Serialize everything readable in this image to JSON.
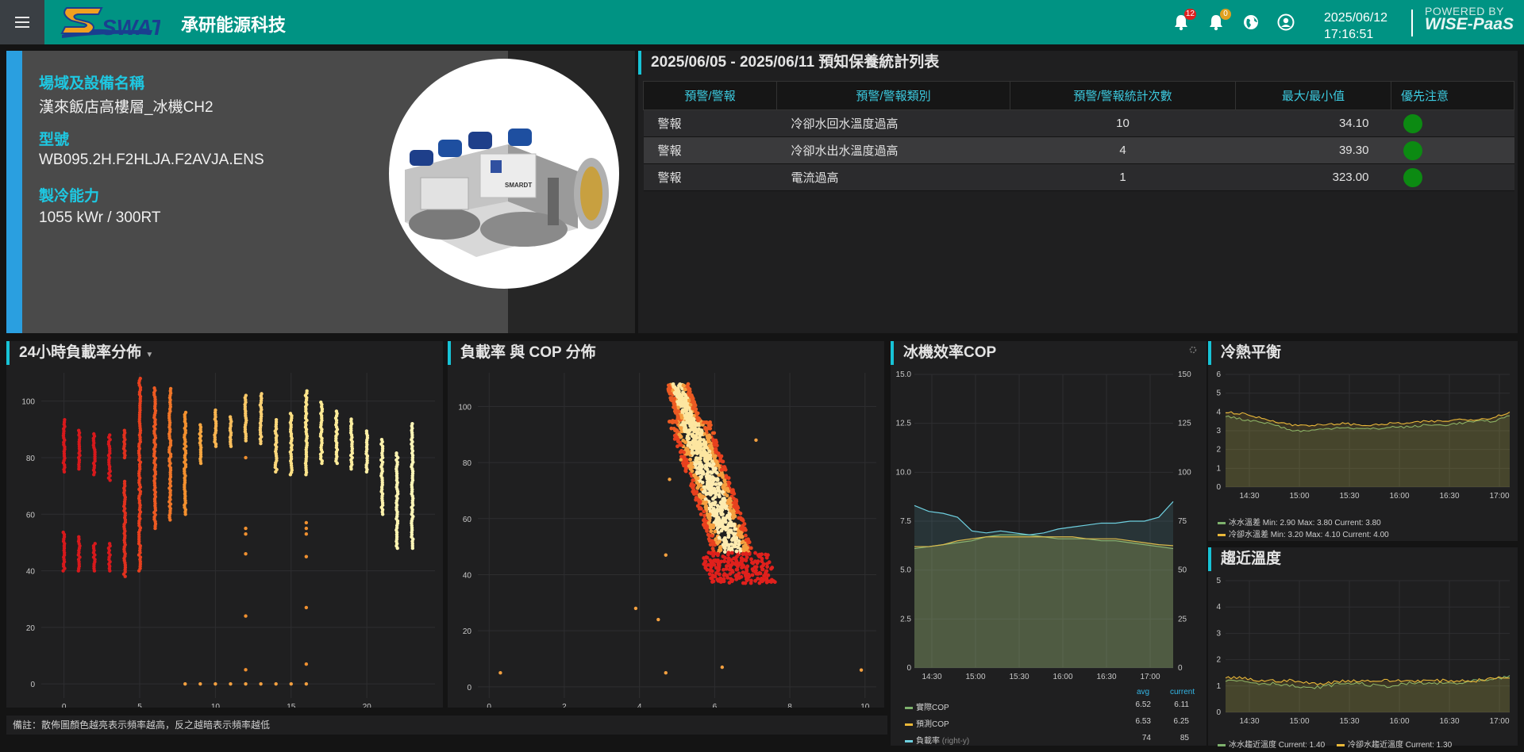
{
  "header": {
    "brand": "承研能源科技",
    "logo_text": "SWAT",
    "notif_count_red": "12",
    "notif_count_yellow": "0",
    "date": "2025/06/12",
    "time": "17:16:51",
    "powered_line1": "POWERED BY",
    "powered_line2": "WISE-PaaS",
    "colors": {
      "bar": "#009383",
      "badge_red": "#e02020",
      "badge_yellow": "#e0a020"
    }
  },
  "equipment": {
    "site_label": "場域及設備名稱",
    "site_value": "漢來飯店高樓層_冰機CH2",
    "model_label": "型號",
    "model_value": "WB095.2H.F2HLJA.F2AVJA.ENS",
    "capacity_label": "製冷能力",
    "capacity_value": "1055 kWr / 300RT",
    "image_logo": "SMARDT"
  },
  "maintenance": {
    "title": "2025/06/05 - 2025/06/11 預知保養統計列表",
    "columns": [
      "預警/警報",
      "預警/警報類別",
      "預警/警報統計次數",
      "最大/最小值",
      "優先注意"
    ],
    "rows": [
      {
        "level": "警報",
        "category": "冷卻水回水溫度過高",
        "count": "10",
        "value": "34.10",
        "priority": "green"
      },
      {
        "level": "警報",
        "category": "冷卻水出水溫度過高",
        "count": "4",
        "value": "39.30",
        "priority": "green"
      },
      {
        "level": "警報",
        "category": "電流過高",
        "count": "1",
        "value": "323.00",
        "priority": "green"
      }
    ]
  },
  "load_24h": {
    "title": "24小時負載率分佈",
    "chart_data": {
      "type": "scatter",
      "title": "24小時負載率分佈",
      "xlim": [
        -1.5,
        24.5
      ],
      "ylim": [
        -5,
        110
      ],
      "x_ticks": [
        0,
        5,
        10,
        15,
        20
      ],
      "y_ticks": [
        0,
        20,
        40,
        60,
        80,
        100
      ],
      "columns": [
        {
          "x": 0,
          "ranges": [
            [
              40,
              54
            ],
            [
              75,
              94
            ]
          ],
          "color": "#d7191c"
        },
        {
          "x": 1,
          "ranges": [
            [
              40,
              52
            ],
            [
              76,
              90
            ]
          ],
          "color": "#d7191c"
        },
        {
          "x": 2,
          "ranges": [
            [
              40,
              50
            ],
            [
              74,
              89
            ]
          ],
          "color": "#d7191c"
        },
        {
          "x": 3,
          "ranges": [
            [
              40,
              50
            ],
            [
              72,
              88
            ]
          ],
          "color": "#d7191c"
        },
        {
          "x": 4,
          "ranges": [
            [
              38,
              72
            ],
            [
              80,
              90
            ]
          ],
          "color": "#e0301e"
        },
        {
          "x": 5,
          "ranges": [
            [
              40,
              108
            ]
          ],
          "color": "#e8401e"
        },
        {
          "x": 6,
          "ranges": [
            [
              55,
              105
            ]
          ],
          "color": "#ec5a22"
        },
        {
          "x": 7,
          "ranges": [
            [
              58,
              105
            ]
          ],
          "color": "#f07628"
        },
        {
          "x": 8,
          "ranges": [
            [
              60,
              96
            ]
          ],
          "color": "#f3902e"
        },
        {
          "x": 9,
          "ranges": [
            [
              78,
              92
            ]
          ],
          "color": "#f6a640"
        },
        {
          "x": 10,
          "ranges": [
            [
              84,
              97
            ]
          ],
          "color": "#f8b450"
        },
        {
          "x": 11,
          "ranges": [
            [
              84,
              95
            ]
          ],
          "color": "#f9be5c"
        },
        {
          "x": 12,
          "ranges": [
            [
              86,
              102
            ]
          ],
          "color": "#fac867"
        },
        {
          "x": 13,
          "ranges": [
            [
              85,
              103
            ]
          ],
          "color": "#fbd073"
        },
        {
          "x": 14,
          "ranges": [
            [
              75,
              94
            ]
          ],
          "color": "#fcd87c"
        },
        {
          "x": 15,
          "ranges": [
            [
              74,
              96
            ]
          ],
          "color": "#fde084"
        },
        {
          "x": 16,
          "ranges": [
            [
              74,
              104
            ]
          ],
          "color": "#fde58c"
        },
        {
          "x": 17,
          "ranges": [
            [
              78,
              100
            ]
          ],
          "color": "#fdea94"
        },
        {
          "x": 18,
          "ranges": [
            [
              78,
              97
            ]
          ],
          "color": "#fdec9a"
        },
        {
          "x": 19,
          "ranges": [
            [
              76,
              94
            ]
          ],
          "color": "#fdeea0"
        },
        {
          "x": 20,
          "ranges": [
            [
              75,
              90
            ]
          ],
          "color": "#fdf0a6"
        },
        {
          "x": 21,
          "ranges": [
            [
              60,
              87
            ]
          ],
          "color": "#fdf2ac"
        },
        {
          "x": 22,
          "ranges": [
            [
              48,
              82
            ]
          ],
          "color": "#fdf4b2"
        },
        {
          "x": 23,
          "ranges": [
            [
              48,
              92
            ]
          ],
          "color": "#fdf6b8"
        }
      ],
      "points": [
        {
          "x": 8,
          "y": 0
        },
        {
          "x": 9,
          "y": 0
        },
        {
          "x": 10,
          "y": 0
        },
        {
          "x": 11,
          "y": 0
        },
        {
          "x": 12,
          "y": 0
        },
        {
          "x": 13,
          "y": 0
        },
        {
          "x": 14,
          "y": 0
        },
        {
          "x": 15,
          "y": 0
        },
        {
          "x": 16,
          "y": 0
        },
        {
          "x": 12,
          "y": 5
        },
        {
          "x": 12,
          "y": 24
        },
        {
          "x": 12,
          "y": 46
        },
        {
          "x": 12,
          "y": 53
        },
        {
          "x": 12,
          "y": 55
        },
        {
          "x": 16,
          "y": 7
        },
        {
          "x": 16,
          "y": 27
        },
        {
          "x": 16,
          "y": 45
        },
        {
          "x": 16,
          "y": 53
        },
        {
          "x": 16,
          "y": 55
        },
        {
          "x": 16,
          "y": 57
        },
        {
          "x": 12,
          "y": 80
        }
      ]
    }
  },
  "load_cop": {
    "title": "負載率 與 COP 分佈",
    "chart_data": {
      "type": "scatter",
      "title": "負載率 與 COP 分佈",
      "xlim": [
        -0.3,
        10.3
      ],
      "ylim": [
        -4,
        112
      ],
      "x_ticks": [
        0,
        2,
        4,
        6,
        8,
        10
      ],
      "y_ticks": [
        0,
        20,
        40,
        60,
        80,
        100
      ],
      "cluster": {
        "x_center_at_y100": 5.2,
        "x_center_at_y40": 6.7,
        "y_range": [
          37,
          108
        ]
      },
      "outliers": [
        {
          "x": 0.3,
          "y": 5
        },
        {
          "x": 3.9,
          "y": 28
        },
        {
          "x": 4.5,
          "y": 24
        },
        {
          "x": 4.7,
          "y": 5
        },
        {
          "x": 4.7,
          "y": 47
        },
        {
          "x": 4.8,
          "y": 74
        },
        {
          "x": 5.1,
          "y": 81
        },
        {
          "x": 6.2,
          "y": 7
        },
        {
          "x": 9.9,
          "y": 6
        },
        {
          "x": 7.1,
          "y": 88
        }
      ]
    }
  },
  "cop": {
    "title": "冰機效率COP",
    "chart_data": {
      "type": "area",
      "title": "冰機效率COP",
      "x_ticks": [
        "14:30",
        "15:00",
        "15:30",
        "16:00",
        "16:30",
        "17:00"
      ],
      "ylim_left": [
        0,
        15
      ],
      "y_ticks_left": [
        "0",
        "2.5",
        "5.0",
        "7.5",
        "10.0",
        "12.5",
        "15.0"
      ],
      "ylim_right": [
        0,
        150
      ],
      "y_ticks_right": [
        "0",
        "25",
        "50",
        "75",
        "100",
        "125",
        "150"
      ],
      "series": [
        {
          "name": "實際COP",
          "color": "#7eb26d",
          "avg": "6.52",
          "current": "6.11",
          "values": [
            6.1,
            6.2,
            6.3,
            6.4,
            6.5,
            6.7,
            6.8,
            6.8,
            6.8,
            6.7,
            6.6,
            6.6,
            6.6,
            6.5,
            6.5,
            6.4,
            6.3,
            6.2,
            6.1
          ]
        },
        {
          "name": "預測COP",
          "color": "#eab839",
          "avg": "6.53",
          "current": "6.25",
          "values": [
            6.2,
            6.2,
            6.3,
            6.5,
            6.6,
            6.7,
            6.7,
            6.7,
            6.7,
            6.7,
            6.7,
            6.7,
            6.6,
            6.6,
            6.6,
            6.5,
            6.4,
            6.3,
            6.25
          ]
        },
        {
          "name": "負載率",
          "suffix": "(right-y)",
          "color": "#6ed0e0",
          "avg": "74",
          "current": "85",
          "values": [
            83,
            80,
            79,
            77,
            70,
            69,
            70,
            69,
            68,
            69,
            71,
            72,
            73,
            74,
            74,
            75,
            75,
            77,
            85
          ]
        }
      ],
      "legend_headers": [
        "avg",
        "current"
      ]
    }
  },
  "heat_balance": {
    "title": "冷熱平衡",
    "chart_data": {
      "type": "line",
      "title": "冷熱平衡",
      "ylim": [
        0,
        6
      ],
      "y_ticks": [
        "0",
        "1",
        "2",
        "3",
        "4",
        "5",
        "6"
      ],
      "x_ticks": [
        "14:30",
        "15:00",
        "15:30",
        "16:00",
        "16:30",
        "17:00"
      ],
      "series": [
        {
          "name": "冰水溫差",
          "color": "#7eb26d",
          "legend": "Min: 2.90  Max: 3.80  Current: 3.80",
          "values": [
            3.8,
            3.6,
            3.5,
            3.3,
            3.0,
            3.0,
            3.1,
            3.2,
            3.1,
            3.1,
            3.2,
            3.2,
            3.3,
            3.3,
            3.4,
            3.5,
            3.5,
            3.8
          ]
        },
        {
          "name": "冷卻水溫差",
          "color": "#eab839",
          "legend": "Min: 3.20  Max: 4.10  Current: 4.00",
          "values": [
            4.0,
            3.9,
            3.7,
            3.5,
            3.3,
            3.3,
            3.3,
            3.4,
            3.3,
            3.3,
            3.4,
            3.4,
            3.5,
            3.5,
            3.6,
            3.6,
            3.7,
            4.0
          ]
        }
      ]
    }
  },
  "approach_temp": {
    "title": "趨近溫度",
    "chart_data": {
      "type": "line",
      "title": "趨近溫度",
      "ylim": [
        0,
        5
      ],
      "y_ticks": [
        "0",
        "1",
        "2",
        "3",
        "4",
        "5"
      ],
      "x_ticks": [
        "14:30",
        "15:00",
        "15:30",
        "16:00",
        "16:30",
        "17:00"
      ],
      "series": [
        {
          "name": "冰水趨近溫度",
          "color": "#7eb26d",
          "legend": "Current: 1.40",
          "values": [
            1.2,
            1.2,
            1.1,
            1.1,
            1.0,
            0.9,
            1.0,
            1.1,
            1.1,
            1.0,
            1.0,
            1.1,
            1.1,
            1.1,
            1.1,
            1.2,
            1.2,
            1.4
          ]
        },
        {
          "name": "冷卻水趨近溫度",
          "color": "#eab839",
          "legend": "Current: 1.30",
          "values": [
            1.3,
            1.3,
            1.2,
            1.2,
            1.2,
            1.1,
            1.1,
            1.2,
            1.2,
            1.2,
            1.2,
            1.2,
            1.2,
            1.2,
            1.2,
            1.2,
            1.3,
            1.3
          ]
        }
      ]
    }
  },
  "footer_note": "備註：散佈圖顏色越亮表示頻率越高，反之越暗表示頻率越低"
}
